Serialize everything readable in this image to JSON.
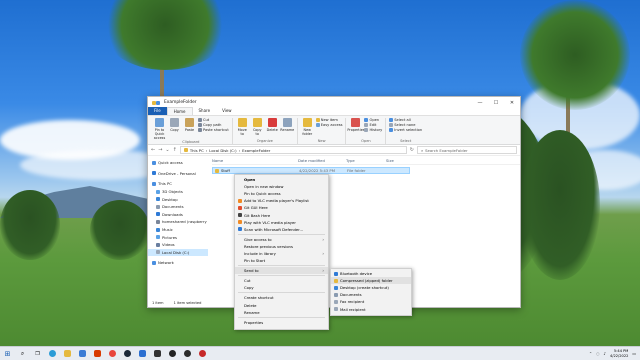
{
  "window": {
    "title": "ExampleFolder",
    "controls": [
      "—",
      "☐",
      "✕"
    ]
  },
  "ribbon": {
    "tabs": [
      "File",
      "Home",
      "Share",
      "View"
    ],
    "groups": [
      {
        "label": "Clipboard",
        "big": [
          "Pin to Quick access",
          "Copy",
          "Paste"
        ],
        "small": [
          "Cut",
          "Copy path",
          "Paste shortcut"
        ]
      },
      {
        "label": "Organize",
        "big": [
          "Move to",
          "Copy to",
          "Delete",
          "Rename"
        ]
      },
      {
        "label": "New",
        "big": [
          "New folder"
        ],
        "small": [
          "New item",
          "Easy access"
        ]
      },
      {
        "label": "Open",
        "big": [
          "Properties"
        ],
        "small": [
          "Open",
          "Edit",
          "History"
        ]
      },
      {
        "label": "Select",
        "small": [
          "Select all",
          "Select none",
          "Invert selection"
        ]
      }
    ]
  },
  "address": {
    "crumbs": [
      "This PC",
      "Local Disk (C:)",
      "ExampleFolder"
    ],
    "search_placeholder": "Search ExampleFolder"
  },
  "nav_pane": {
    "items": [
      "Quick access",
      "OneDrive - Personal",
      "This PC",
      "3D Objects",
      "Desktop",
      "Documents",
      "Downloads",
      "homeshared (raspberry",
      "Music",
      "Pictures",
      "Videos",
      "Local Disk (C:)",
      "Network"
    ]
  },
  "columns": [
    "Name",
    "Date modified",
    "Type",
    "Size"
  ],
  "files": [
    {
      "name": "Stuff",
      "date": "4/22/2022 5:43 PM",
      "type": "File folder",
      "size": ""
    }
  ],
  "status": {
    "count": "1 item",
    "selected": "1 item selected"
  },
  "context_menu": {
    "items": [
      {
        "label": "Open"
      },
      {
        "label": "Open in new window"
      },
      {
        "label": "Pin to Quick access"
      },
      {
        "label": "Add to VLC media player's Playlist"
      },
      {
        "label": "Git GUI Here"
      },
      {
        "label": "Git Bash Here"
      },
      {
        "label": "Play with VLC media player"
      },
      {
        "label": "Scan with Microsoft Defender..."
      },
      {
        "label": "Give access to"
      },
      {
        "label": "Restore previous versions"
      },
      {
        "label": "Include in library"
      },
      {
        "label": "Pin to Start"
      },
      {
        "label": "Send to"
      },
      {
        "label": "Cut"
      },
      {
        "label": "Copy"
      },
      {
        "label": "Create shortcut"
      },
      {
        "label": "Delete"
      },
      {
        "label": "Rename"
      },
      {
        "label": "Properties"
      }
    ]
  },
  "send_to": {
    "items": [
      "Bluetooth device",
      "Compressed (zipped) folder",
      "Desktop (create shortcut)",
      "Documents",
      "Fax recipient",
      "Mail recipient"
    ]
  },
  "taskbar": {
    "time": "5:44 PM",
    "date": "4/22/2022",
    "accent": "#1a5fb4"
  }
}
